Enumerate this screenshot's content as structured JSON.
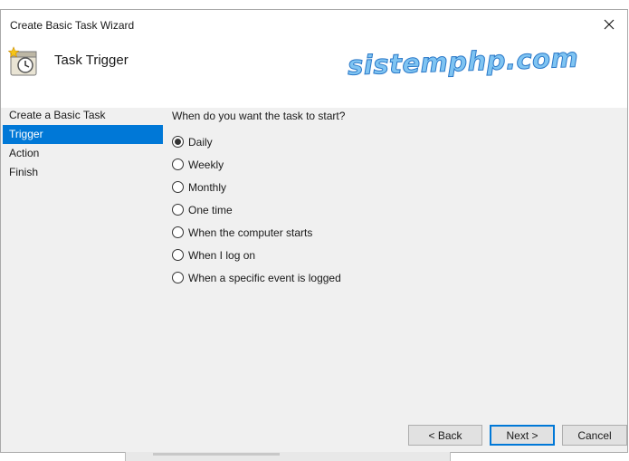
{
  "window": {
    "title": "Create Basic Task Wizard",
    "close_icon": "close-icon"
  },
  "header": {
    "title": "Task Trigger",
    "icon": "task-scheduler-icon",
    "watermark": "sistemphp.com"
  },
  "nav": {
    "items": [
      {
        "label": "Create a Basic Task",
        "selected": false
      },
      {
        "label": "Trigger",
        "selected": true
      },
      {
        "label": "Action",
        "selected": false
      },
      {
        "label": "Finish",
        "selected": false
      }
    ]
  },
  "content": {
    "question": "When do you want the task to start?",
    "options": [
      {
        "label": "Daily",
        "checked": true
      },
      {
        "label": "Weekly",
        "checked": false
      },
      {
        "label": "Monthly",
        "checked": false
      },
      {
        "label": "One time",
        "checked": false
      },
      {
        "label": "When the computer starts",
        "checked": false
      },
      {
        "label": "When I log on",
        "checked": false
      },
      {
        "label": "When a specific event is logged",
        "checked": false
      }
    ]
  },
  "buttons": {
    "back": "< Back",
    "next": "Next >",
    "cancel": "Cancel"
  },
  "colors": {
    "accent": "#0078d7",
    "watermark": "#7fc4f2"
  }
}
